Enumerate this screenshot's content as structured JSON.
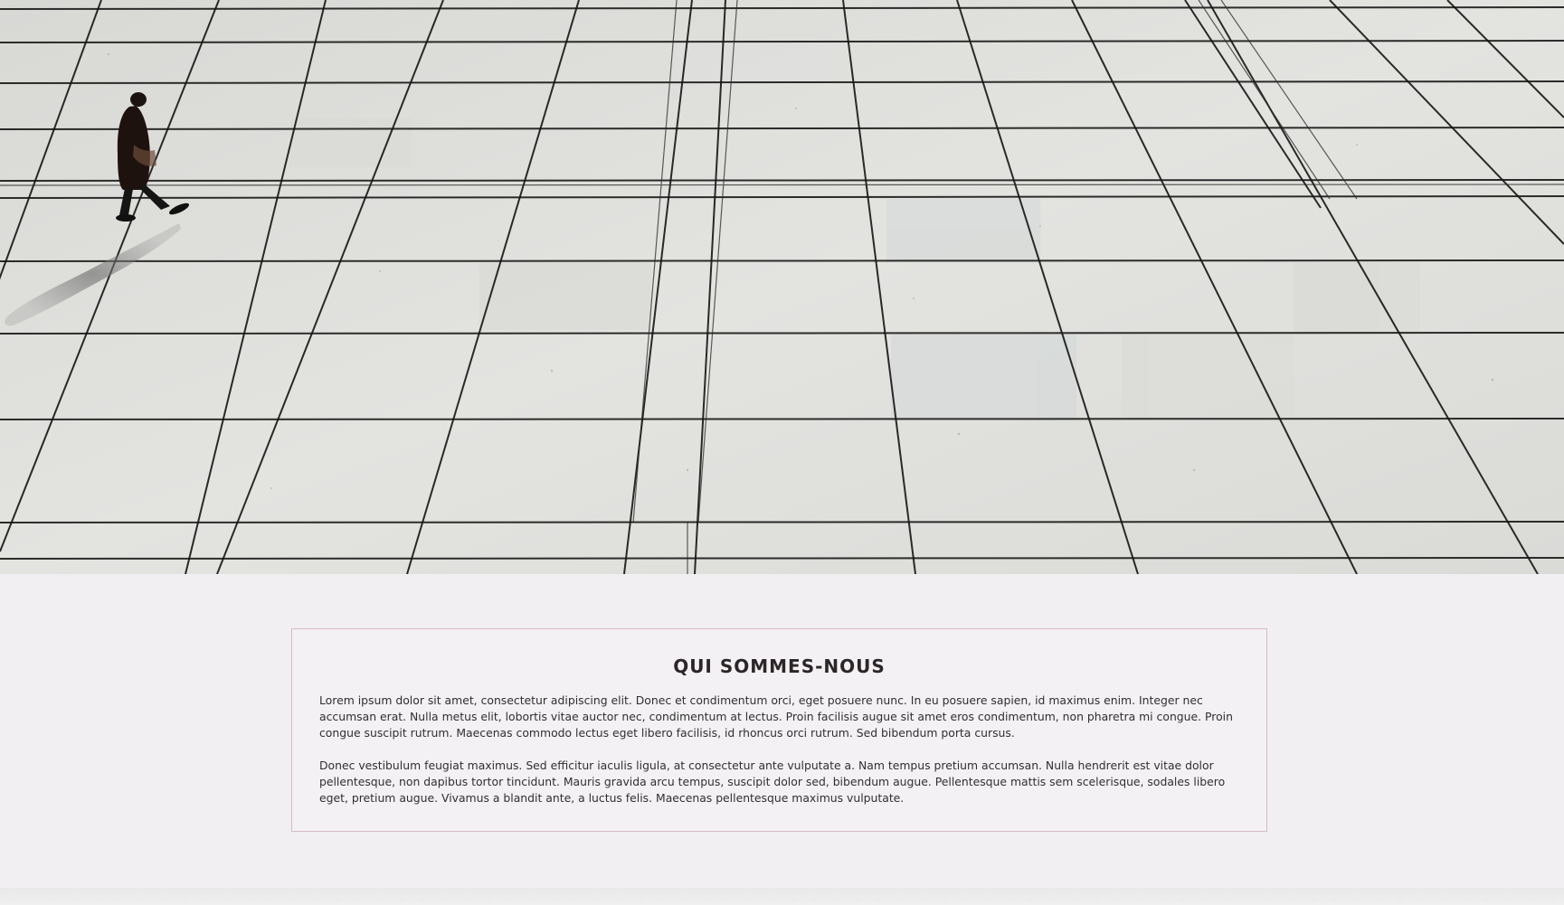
{
  "hero": {
    "image_alt": "Elevated view of a lone person walking across a paved plaza"
  },
  "about": {
    "title": "QUI SOMMES-NOUS",
    "paragraphs": [
      "Lorem ipsum dolor sit amet, consectetur adipiscing elit. Donec et condimentum orci, eget posuere nunc. In eu posuere sapien, id maximus enim. Integer nec accumsan erat. Nulla metus elit, lobortis vitae auctor nec, condimentum at lectus. Proin facilisis augue sit amet eros condimentum, non pharetra mi congue. Proin congue suscipit rutrum. Maecenas commodo lectus eget libero facilisis, id rhoncus orci rutrum. Sed bibendum porta cursus.",
      "Donec vestibulum feugiat maximus. Sed efficitur iaculis ligula, at consectetur ante vulputate a. Nam tempus pretium accumsan. Nulla hendrerit est vitae dolor pellentesque, non dapibus tortor tincidunt. Mauris gravida arcu tempus, suscipit dolor sed, bibendum augue. Pellentesque mattis sem scelerisque, sodales libero eget, pretium augue. Vivamus a blandit ante, a luctus felis. Maecenas pellentesque maximus vulputate."
    ]
  },
  "colors": {
    "page_background": "#f1eff1",
    "card_border": "#d6b9c8",
    "title_text": "#2b2628",
    "body_text": "#303030",
    "pavement": "#dcdcd8",
    "joint_lines": "#141414"
  }
}
